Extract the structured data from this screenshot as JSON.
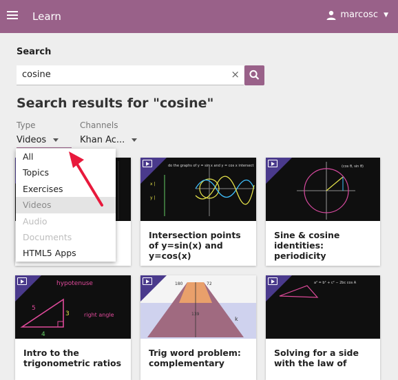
{
  "appbar": {
    "title": "Learn",
    "username": "marcosc"
  },
  "search": {
    "label": "Search",
    "value": "cosine",
    "clear_icon": "×"
  },
  "results": {
    "heading": "Search results for \"cosine\""
  },
  "filters": {
    "type": {
      "label": "Type",
      "selected": "Videos"
    },
    "channels": {
      "label": "Channels",
      "selected": "Khan Ac..."
    }
  },
  "type_dropdown": {
    "options": [
      {
        "label": "All",
        "state": "normal"
      },
      {
        "label": "Topics",
        "state": "normal"
      },
      {
        "label": "Exercises",
        "state": "normal"
      },
      {
        "label": "Videos",
        "state": "selected"
      },
      {
        "label": "Audio",
        "state": "disabled"
      },
      {
        "label": "Documents",
        "state": "disabled"
      },
      {
        "label": "HTML5 Apps",
        "state": "normal"
      }
    ]
  },
  "cards": [
    {
      "title": "",
      "icon": "video-icon"
    },
    {
      "title": "Intersection points of y=sin(x) and y=cos(x)",
      "icon": "video-icon"
    },
    {
      "title": "Sine & cosine identities: periodicity",
      "icon": "video-icon"
    },
    {
      "title": "Intro to the trigonometric ratios",
      "icon": "video-icon"
    },
    {
      "title": "Trig word problem: complementary",
      "icon": "video-icon"
    },
    {
      "title": "Solving for a side with the law of",
      "icon": "video-icon"
    }
  ],
  "colors": {
    "brand": "#996189",
    "badge": "#4a3a8c",
    "arrow": "#e8193c"
  }
}
